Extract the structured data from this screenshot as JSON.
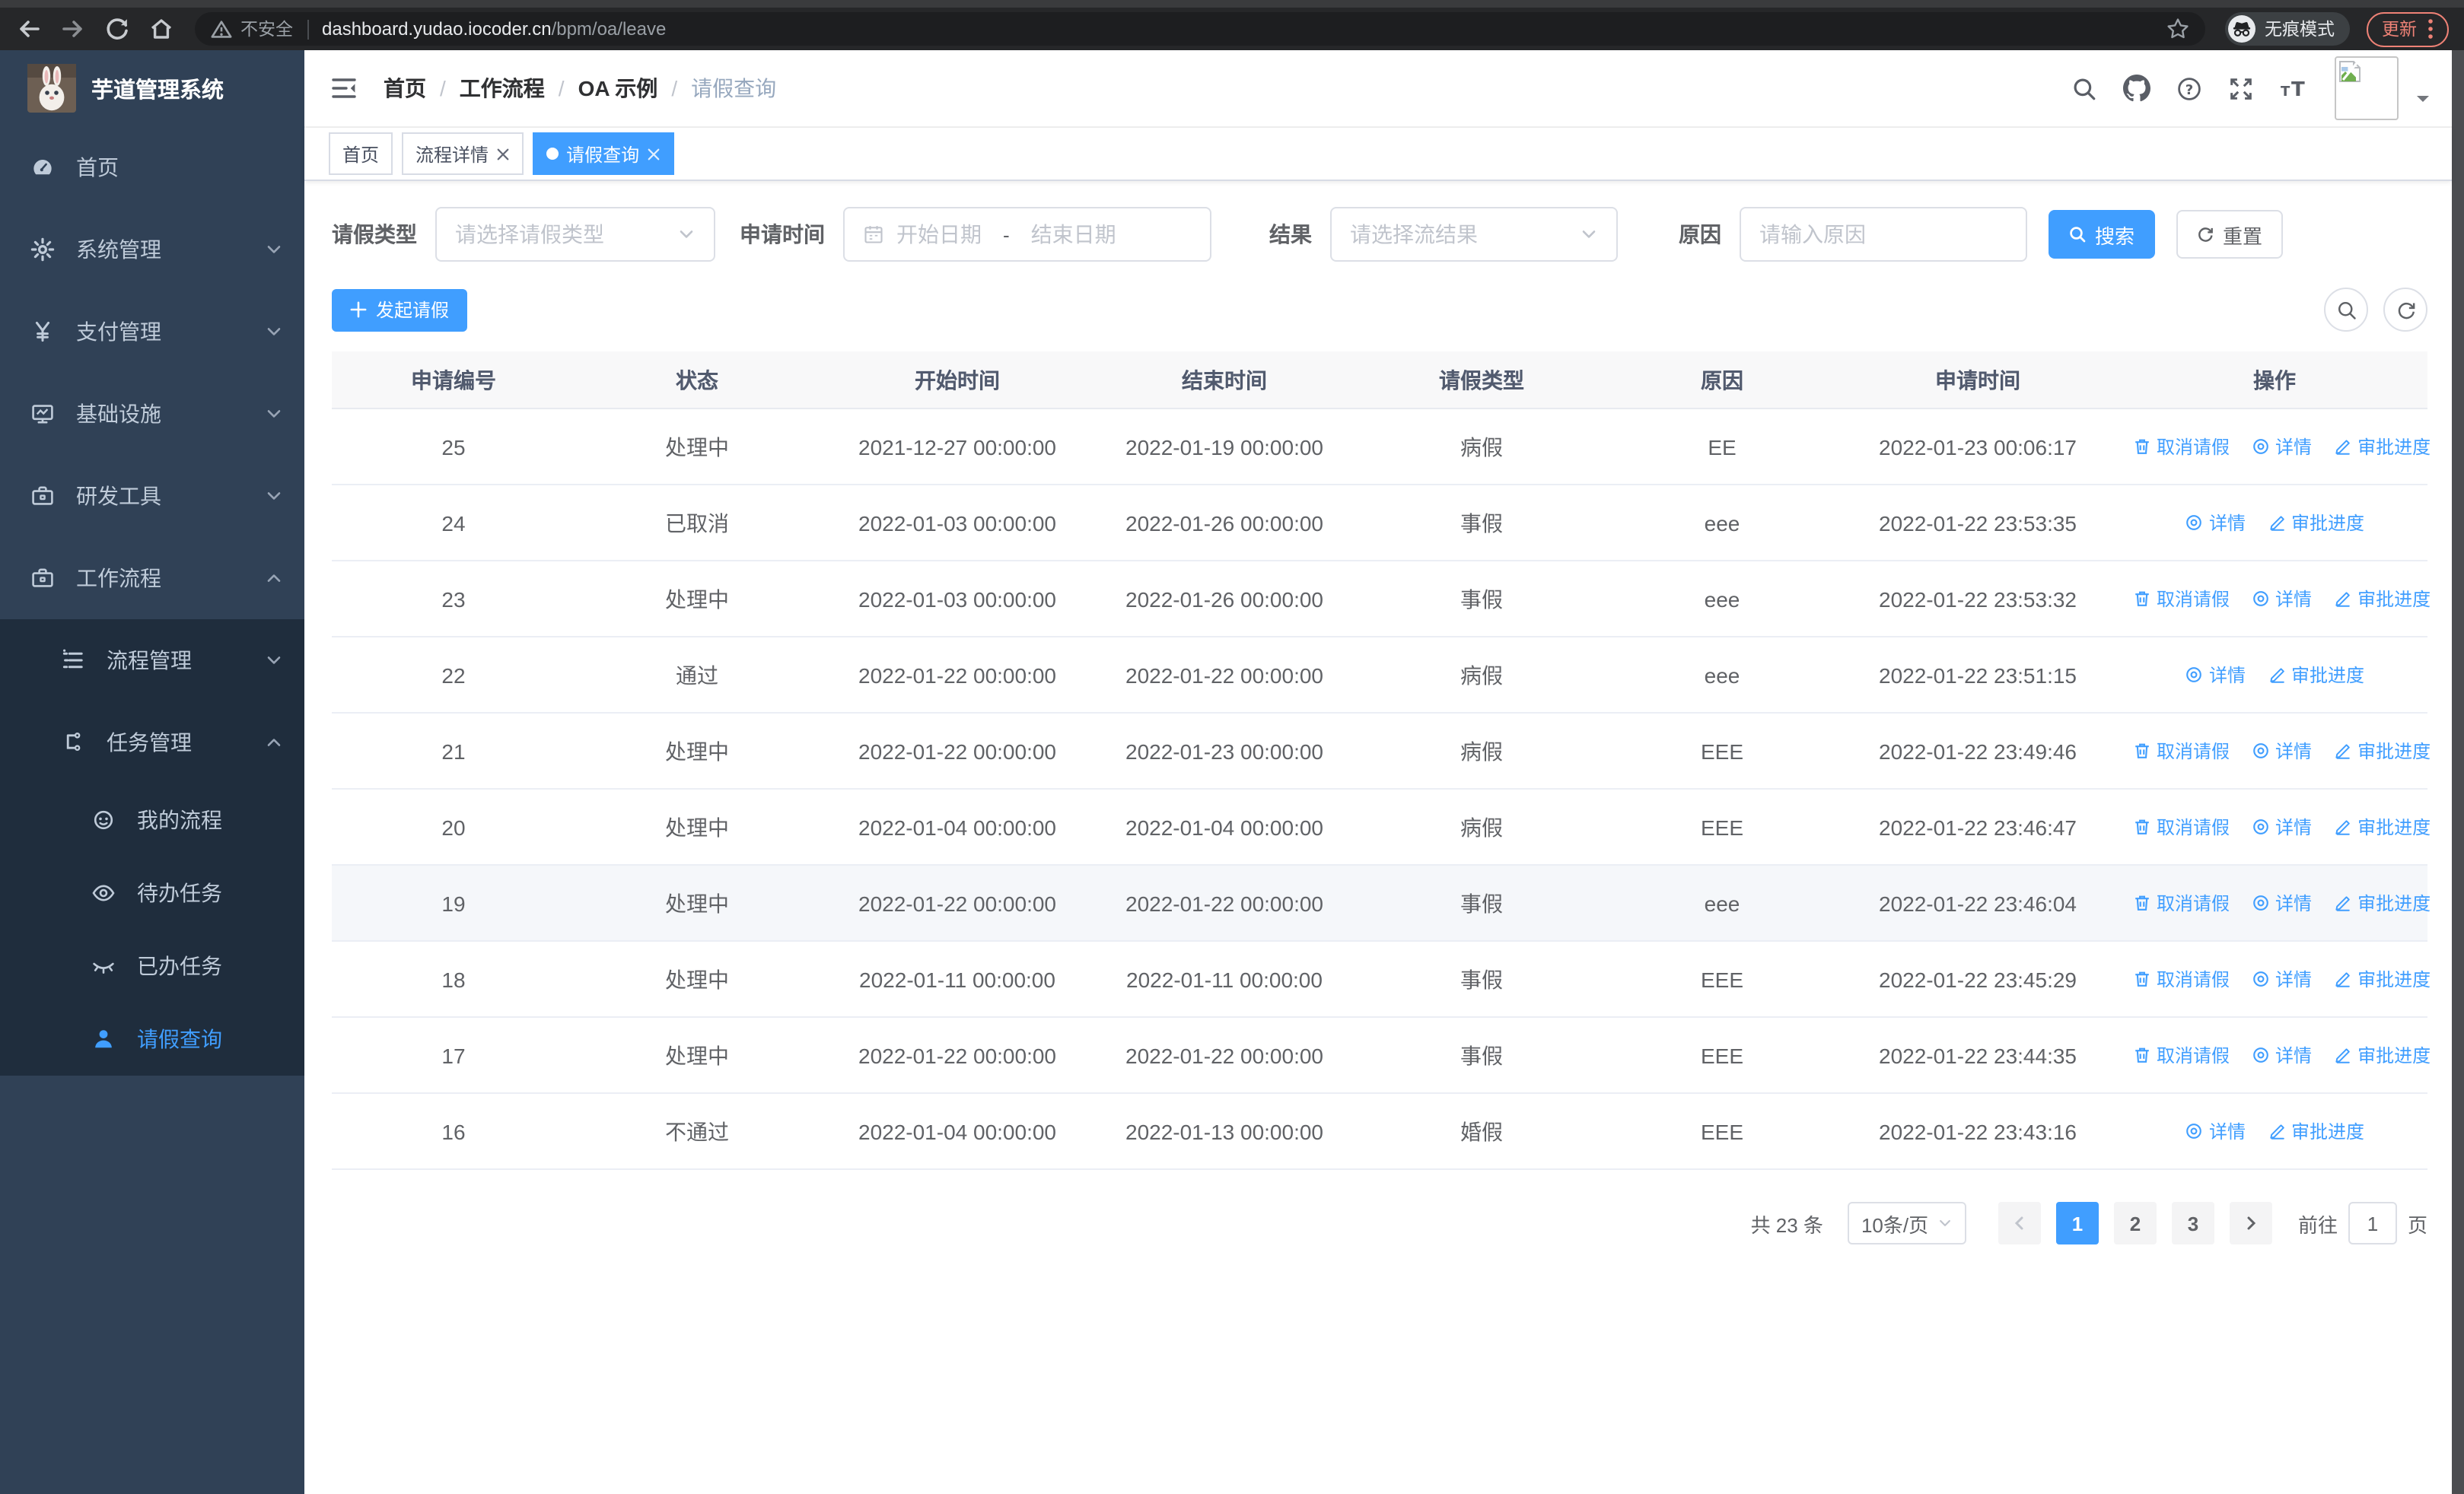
{
  "browser": {
    "security_label": "不安全",
    "url_host": "dashboard.yudao.iocoder.cn",
    "url_path": "/bpm/oa/leave",
    "incognito_label": "无痕模式",
    "update_label": "更新"
  },
  "sidebar": {
    "title": "芋道管理系统",
    "menu": [
      {
        "label": "首页",
        "icon": "dashboard-icon"
      },
      {
        "label": "系统管理",
        "icon": "gear-icon",
        "chevron": "down"
      },
      {
        "label": "支付管理",
        "icon": "yen-icon",
        "chevron": "down"
      },
      {
        "label": "基础设施",
        "icon": "monitor-icon",
        "chevron": "down"
      },
      {
        "label": "研发工具",
        "icon": "toolbox-icon",
        "chevron": "down"
      },
      {
        "label": "工作流程",
        "icon": "suitcase-icon",
        "chevron": "up"
      }
    ],
    "submenu": [
      {
        "label": "流程管理",
        "icon": "flow-icon",
        "chevron": "down",
        "level": 1
      },
      {
        "label": "任务管理",
        "icon": "tree-icon",
        "chevron": "up",
        "level": 1
      },
      {
        "label": "我的流程",
        "icon": "face-icon",
        "level": 2
      },
      {
        "label": "待办任务",
        "icon": "eye-icon",
        "level": 2
      },
      {
        "label": "已办任务",
        "icon": "eye-closed-icon",
        "level": 2
      },
      {
        "label": "请假查询",
        "icon": "user-icon",
        "level": 2,
        "active": true
      }
    ]
  },
  "header": {
    "breadcrumb": [
      "首页",
      "工作流程",
      "OA 示例",
      "请假查询"
    ],
    "separator": "/"
  },
  "tabs": [
    {
      "label": "首页",
      "closable": false,
      "active": false
    },
    {
      "label": "流程详情",
      "closable": true,
      "active": false
    },
    {
      "label": "请假查询",
      "closable": true,
      "active": true
    }
  ],
  "filters": {
    "leave_type_label": "请假类型",
    "leave_type_placeholder": "请选择请假类型",
    "apply_time_label": "申请时间",
    "start_placeholder": "开始日期",
    "range_separator": "-",
    "end_placeholder": "结束日期",
    "result_label": "结果",
    "result_placeholder": "请选择流结果",
    "reason_label": "原因",
    "reason_placeholder": "请输入原因",
    "search_label": "搜索",
    "reset_label": "重置"
  },
  "toolbar": {
    "create_label": "发起请假"
  },
  "table": {
    "columns": [
      "申请编号",
      "状态",
      "开始时间",
      "结束时间",
      "请假类型",
      "原因",
      "申请时间",
      "操作"
    ],
    "action_labels": {
      "cancel": "取消请假",
      "detail": "详情",
      "progress": "审批进度"
    },
    "rows": [
      {
        "id": "25",
        "status": "处理中",
        "start": "2021-12-27 00:00:00",
        "end": "2022-01-19 00:00:00",
        "type": "病假",
        "reason": "EE",
        "applied": "2022-01-23 00:06:17",
        "actions": [
          "cancel",
          "detail",
          "progress"
        ],
        "hover": false
      },
      {
        "id": "24",
        "status": "已取消",
        "start": "2022-01-03 00:00:00",
        "end": "2022-01-26 00:00:00",
        "type": "事假",
        "reason": "eee",
        "applied": "2022-01-22 23:53:35",
        "actions": [
          "detail",
          "progress"
        ],
        "hover": false
      },
      {
        "id": "23",
        "status": "处理中",
        "start": "2022-01-03 00:00:00",
        "end": "2022-01-26 00:00:00",
        "type": "事假",
        "reason": "eee",
        "applied": "2022-01-22 23:53:32",
        "actions": [
          "cancel",
          "detail",
          "progress"
        ],
        "hover": false
      },
      {
        "id": "22",
        "status": "通过",
        "start": "2022-01-22 00:00:00",
        "end": "2022-01-22 00:00:00",
        "type": "病假",
        "reason": "eee",
        "applied": "2022-01-22 23:51:15",
        "actions": [
          "detail",
          "progress"
        ],
        "hover": false
      },
      {
        "id": "21",
        "status": "处理中",
        "start": "2022-01-22 00:00:00",
        "end": "2022-01-23 00:00:00",
        "type": "病假",
        "reason": "EEE",
        "applied": "2022-01-22 23:49:46",
        "actions": [
          "cancel",
          "detail",
          "progress"
        ],
        "hover": false
      },
      {
        "id": "20",
        "status": "处理中",
        "start": "2022-01-04 00:00:00",
        "end": "2022-01-04 00:00:00",
        "type": "病假",
        "reason": "EEE",
        "applied": "2022-01-22 23:46:47",
        "actions": [
          "cancel",
          "detail",
          "progress"
        ],
        "hover": false
      },
      {
        "id": "19",
        "status": "处理中",
        "start": "2022-01-22 00:00:00",
        "end": "2022-01-22 00:00:00",
        "type": "事假",
        "reason": "eee",
        "applied": "2022-01-22 23:46:04",
        "actions": [
          "cancel",
          "detail",
          "progress"
        ],
        "hover": true
      },
      {
        "id": "18",
        "status": "处理中",
        "start": "2022-01-11 00:00:00",
        "end": "2022-01-11 00:00:00",
        "type": "事假",
        "reason": "EEE",
        "applied": "2022-01-22 23:45:29",
        "actions": [
          "cancel",
          "detail",
          "progress"
        ],
        "hover": false
      },
      {
        "id": "17",
        "status": "处理中",
        "start": "2022-01-22 00:00:00",
        "end": "2022-01-22 00:00:00",
        "type": "事假",
        "reason": "EEE",
        "applied": "2022-01-22 23:44:35",
        "actions": [
          "cancel",
          "detail",
          "progress"
        ],
        "hover": false
      },
      {
        "id": "16",
        "status": "不通过",
        "start": "2022-01-04 00:00:00",
        "end": "2022-01-13 00:00:00",
        "type": "婚假",
        "reason": "EEE",
        "applied": "2022-01-22 23:43:16",
        "actions": [
          "detail",
          "progress"
        ],
        "hover": false
      }
    ]
  },
  "pagination": {
    "total_text": "共 23 条",
    "page_size": "10条/页",
    "pages": [
      "1",
      "2",
      "3"
    ],
    "current": "1",
    "jump_prefix": "前往",
    "jump_value": "1",
    "jump_suffix": "页"
  },
  "colors": {
    "primary": "#409eff",
    "sidebar_bg": "#304156",
    "submenu_bg": "#1f2d3d"
  }
}
